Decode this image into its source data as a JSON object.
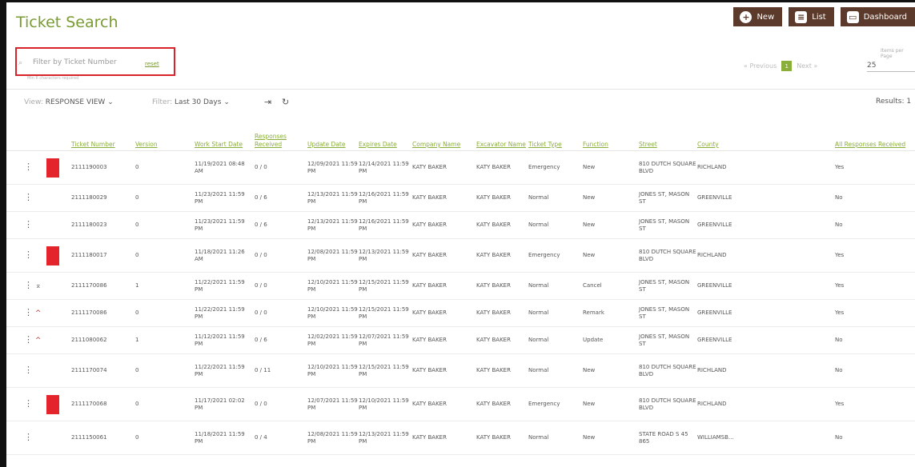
{
  "header": {
    "title": "Ticket Search",
    "buttons": [
      {
        "label": "New",
        "icon": "plus-icon"
      },
      {
        "label": "List",
        "icon": "list-icon"
      },
      {
        "label": "Dashboard",
        "icon": "dashboard-icon"
      }
    ]
  },
  "search": {
    "placeholder": "Filter by Ticket Number",
    "reset_label": "reset",
    "hint": "Min 6 characters required"
  },
  "pager": {
    "previous": "« Previous",
    "current": "1",
    "next": "Next »",
    "items_per_page_label": "Items per Page",
    "items_per_page": "25"
  },
  "toolbar": {
    "view_label": "View:",
    "view_value": "RESPONSE VIEW",
    "filter_label": "Filter:",
    "filter_value": "Last 30 Days",
    "results": "Results: 1"
  },
  "table": {
    "headers": [
      "Ticket Number",
      "Version",
      "Work Start Date",
      "Responses Received",
      "Update Date",
      "Expires Date",
      "Company Name",
      "Excavator Name",
      "Ticket Type",
      "Function",
      "Street",
      "County",
      "All Responses Received"
    ],
    "rows": [
      {
        "flag": true,
        "arrow": "",
        "ticket": "2111190003",
        "version": "0",
        "work_start": "11/19/2021 08:48 AM",
        "responses": "0 / 0",
        "update": "12/09/2021 11:59 PM",
        "expires": "12/14/2021 11:59 PM",
        "company": "KATY BAKER",
        "excavator": "KATY BAKER",
        "type": "Emergency",
        "function": "New",
        "street": "810 DUTCH SQUARE BLVD",
        "county": "RICHLAND",
        "all": "Yes"
      },
      {
        "flag": false,
        "arrow": "",
        "ticket": "2111180029",
        "version": "0",
        "work_start": "11/23/2021 11:59 PM",
        "responses": "0 / 6",
        "update": "12/13/2021 11:59 PM",
        "expires": "12/16/2021 11:59 PM",
        "company": "KATY BAKER",
        "excavator": "KATY BAKER",
        "type": "Normal",
        "function": "New",
        "street": "JONES ST, MASON ST",
        "county": "GREENVILLE",
        "all": "No"
      },
      {
        "flag": false,
        "arrow": "",
        "ticket": "2111180023",
        "version": "0",
        "work_start": "11/23/2021 11:59 PM",
        "responses": "0 / 6",
        "update": "12/13/2021 11:59 PM",
        "expires": "12/16/2021 11:59 PM",
        "company": "KATY BAKER",
        "excavator": "KATY BAKER",
        "type": "Normal",
        "function": "New",
        "street": "JONES ST, MASON ST",
        "county": "GREENVILLE",
        "all": "No"
      },
      {
        "flag": true,
        "arrow": "",
        "ticket": "2111180017",
        "version": "0",
        "work_start": "11/18/2021 11:26 AM",
        "responses": "0 / 0",
        "update": "12/08/2021 11:59 PM",
        "expires": "12/13/2021 11:59 PM",
        "company": "KATY BAKER",
        "excavator": "KATY BAKER",
        "type": "Emergency",
        "function": "New",
        "street": "810 DUTCH SQUARE BLVD",
        "county": "RICHLAND",
        "all": "Yes"
      },
      {
        "flag": false,
        "arrow": "⌅",
        "ticket": "2111170086",
        "version": "1",
        "work_start": "11/22/2021 11:59 PM",
        "responses": "0 / 0",
        "update": "12/10/2021 11:59 PM",
        "expires": "12/15/2021 11:59 PM",
        "company": "KATY BAKER",
        "excavator": "KATY BAKER",
        "type": "Normal",
        "function": "Cancel",
        "street": "JONES ST, MASON ST",
        "county": "GREENVILLE",
        "all": "Yes"
      },
      {
        "flag": false,
        "arrow": "^",
        "ticket": "2111170086",
        "version": "0",
        "work_start": "11/22/2021 11:59 PM",
        "responses": "0 / 0",
        "update": "12/10/2021 11:59 PM",
        "expires": "12/15/2021 11:59 PM",
        "company": "KATY BAKER",
        "excavator": "KATY BAKER",
        "type": "Normal",
        "function": "Remark",
        "street": "JONES ST, MASON ST",
        "county": "GREENVILLE",
        "all": "Yes"
      },
      {
        "flag": false,
        "arrow": "^",
        "ticket": "2111080062",
        "version": "1",
        "work_start": "11/12/2021 11:59 PM",
        "responses": "0 / 6",
        "update": "12/02/2021 11:59 PM",
        "expires": "12/07/2021 11:59 PM",
        "company": "KATY BAKER",
        "excavator": "KATY BAKER",
        "type": "Normal",
        "function": "Update",
        "street": "JONES ST, MASON ST",
        "county": "GREENVILLE",
        "all": "No"
      },
      {
        "flag": false,
        "arrow": "",
        "ticket": "2111170074",
        "version": "0",
        "work_start": "11/22/2021 11:59 PM",
        "responses": "0 / 11",
        "update": "12/10/2021 11:59 PM",
        "expires": "12/15/2021 11:59 PM",
        "company": "KATY BAKER",
        "excavator": "KATY BAKER",
        "type": "Normal",
        "function": "New",
        "street": "810 DUTCH SQUARE BLVD",
        "county": "RICHLAND",
        "all": "No"
      },
      {
        "flag": true,
        "arrow": "",
        "ticket": "2111170068",
        "version": "0",
        "work_start": "11/17/2021 02:02 PM",
        "responses": "0 / 0",
        "update": "12/07/2021 11:59 PM",
        "expires": "12/10/2021 11:59 PM",
        "company": "KATY BAKER",
        "excavator": "KATY BAKER",
        "type": "Emergency",
        "function": "New",
        "street": "810 DUTCH SQUARE BLVD",
        "county": "RICHLAND",
        "all": "Yes"
      },
      {
        "flag": false,
        "arrow": "",
        "ticket": "2111150061",
        "version": "0",
        "work_start": "11/18/2021 11:59 PM",
        "responses": "0 / 4",
        "update": "12/08/2021 11:59 PM",
        "expires": "12/13/2021 11:59 PM",
        "company": "KATY BAKER",
        "excavator": "KATY BAKER",
        "type": "Normal",
        "function": "New",
        "street": "STATE ROAD S 45 865",
        "county": "WILLIAMSB...",
        "all": "No"
      }
    ]
  },
  "colors": {
    "accent_green": "#8aae3a",
    "title_green": "#7a9a32",
    "header_button_bg": "#5b3a2b",
    "emergency_flag": "#e3242b",
    "highlight_border": "#d8232a"
  }
}
